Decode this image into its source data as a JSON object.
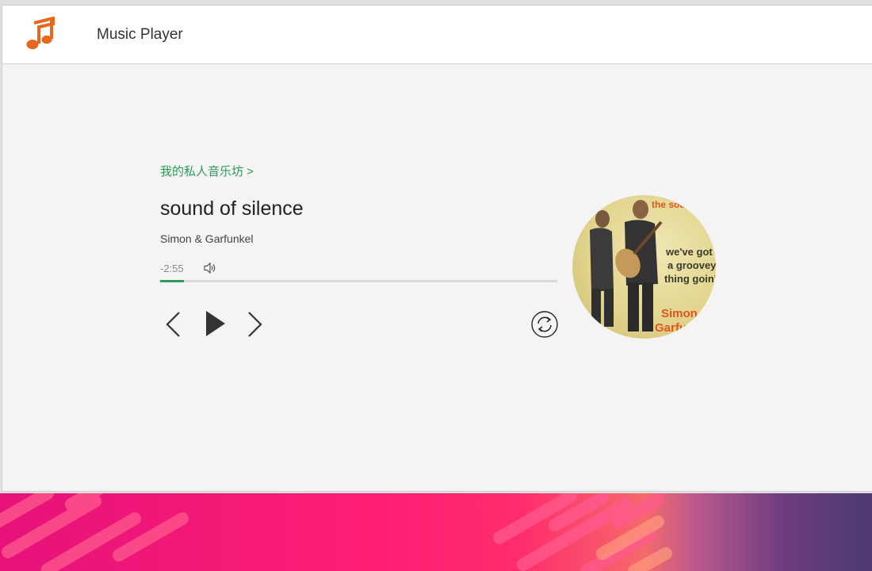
{
  "app": {
    "title": "Music Player",
    "logo_icon": "music-note-icon"
  },
  "player": {
    "playlist_link": "我的私人音乐坊 >",
    "song_title": "sound of silence",
    "artist": "Simon & Garfunkel",
    "time_remaining": "-2:55",
    "progress": 0.06,
    "controls": {
      "prev_icon": "chevron-left-icon",
      "play_icon": "play-icon",
      "next_icon": "chevron-right-icon",
      "loop_icon": "loop-icon",
      "volume_icon": "volume-icon"
    },
    "cover": {
      "text_top": "the sou… silen…",
      "text_mid_1": "we've got",
      "text_mid_2": "a groovey",
      "text_mid_3": "thing goin'",
      "text_bottom_1": "Simon",
      "text_bottom_2": "Garfu…"
    }
  },
  "colors": {
    "accent": "#2e9a5a",
    "logo": "#e8671a",
    "desktop_pink": "#ff1f74"
  }
}
